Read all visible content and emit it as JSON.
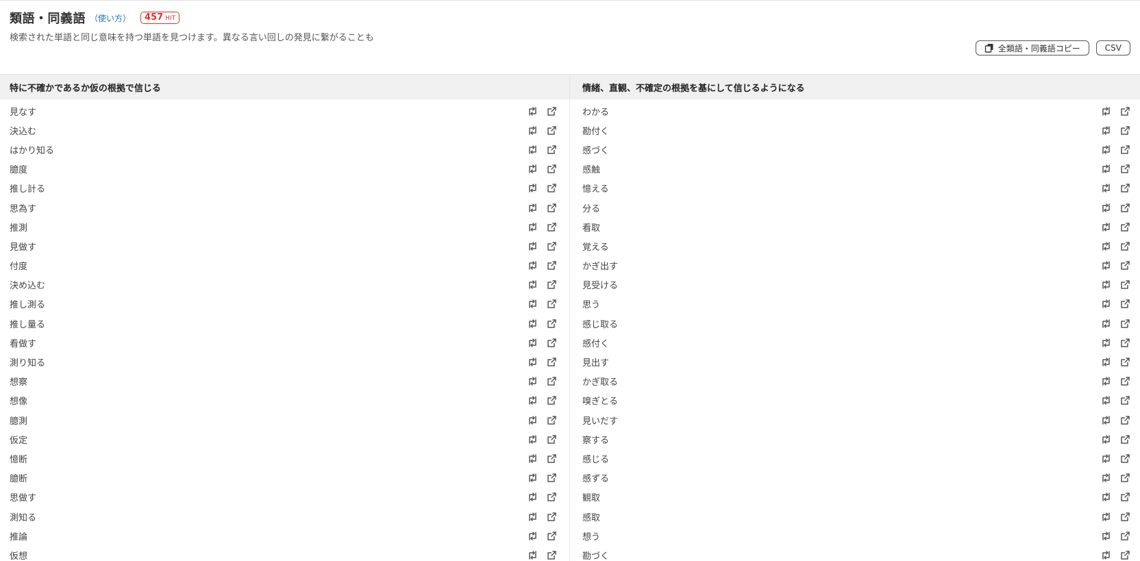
{
  "header": {
    "title": "類語・同義語",
    "howto": "（使い方）",
    "hit_count": "457",
    "hit_label": "HIT",
    "description": "検索された単語と同じ意味を持つ単語を見つけます。異なる言い回しの発見に繋がることも"
  },
  "actions": {
    "copy_all": "全類語・同義語コピー",
    "csv": "CSV"
  },
  "columns": [
    {
      "heading": "特に不確かであるか仮の根拠で信じる",
      "words": [
        "見なす",
        "決込む",
        "はかり知る",
        "臆度",
        "推し計る",
        "思為す",
        "推測",
        "見做す",
        "付度",
        "決め込む",
        "推し測る",
        "推し量る",
        "看做す",
        "測り知る",
        "想察",
        "想像",
        "臆測",
        "仮定",
        "憶断",
        "臆断",
        "思做す",
        "測知る",
        "推論",
        "仮想"
      ]
    },
    {
      "heading": "情緒、直観、不確定の根拠を基にして信じるようになる",
      "words": [
        "わかる",
        "勘付く",
        "感づく",
        "感触",
        "憶える",
        "分る",
        "看取",
        "覚える",
        "かぎ出す",
        "見受ける",
        "思う",
        "感じ取る",
        "感付く",
        "見出す",
        "かぎ取る",
        "嗅ぎとる",
        "見いだす",
        "察する",
        "感じる",
        "感ずる",
        "観取",
        "感取",
        "想う",
        "勘づく"
      ]
    }
  ],
  "icons": {
    "swap": "swap-icon",
    "external": "external-link-icon",
    "copy": "copy-icon"
  }
}
